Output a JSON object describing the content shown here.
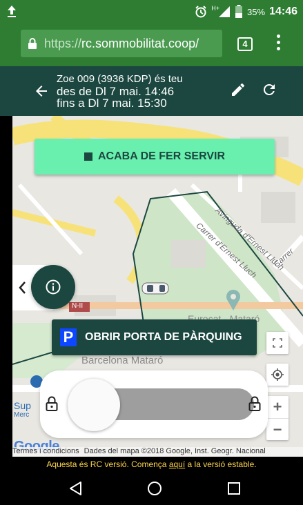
{
  "status_bar": {
    "network_label": "H+",
    "battery": "35%",
    "time": "14:46",
    "icons": [
      "upload-icon",
      "alarm-icon",
      "signal-icon",
      "battery-icon"
    ]
  },
  "browser": {
    "url_scheme": "https://",
    "url_host": "rc.sommobilitat.coop/",
    "tab_count": "4"
  },
  "header": {
    "vehicle": "Zoe 009 (3936 KDP) és teu",
    "from": "des de Dl 7 mai. 14:46",
    "to": "fins a Dl 7 mai. 15:30"
  },
  "map": {
    "streets": [
      "Avinguda d'Ernest Lluch",
      "Carrer d'Ernest Lluch",
      "Carrer"
    ],
    "road_label": "N-II",
    "pois": [
      "Eurocat - Mataró",
      "Barcelona Mataró",
      "Sup",
      "Merc"
    ],
    "finish_button": "ACABA DE FER SERVIR",
    "parking_button": "OBRIR PORTA DE PÀRQUING",
    "parking_icon_letter": "P",
    "zoom_in": "+",
    "zoom_out": "−",
    "google": "Google",
    "attribution": {
      "terms": "Termes i condicions",
      "data": "Dades del mapa ©2018 Google, Inst. Geogr. Nacional"
    },
    "lock_slider_value": 0
  },
  "version_banner": {
    "before": "Aquesta és RC versió. Comença ",
    "link": "aquí",
    "after": " a la versió estable."
  },
  "colors": {
    "status_green": "#2e7d32",
    "header_dark": "#1b4740",
    "accent_green": "#69f0ae",
    "parking_blue": "#0d47ff",
    "banner_yellow": "#ffd54f"
  }
}
